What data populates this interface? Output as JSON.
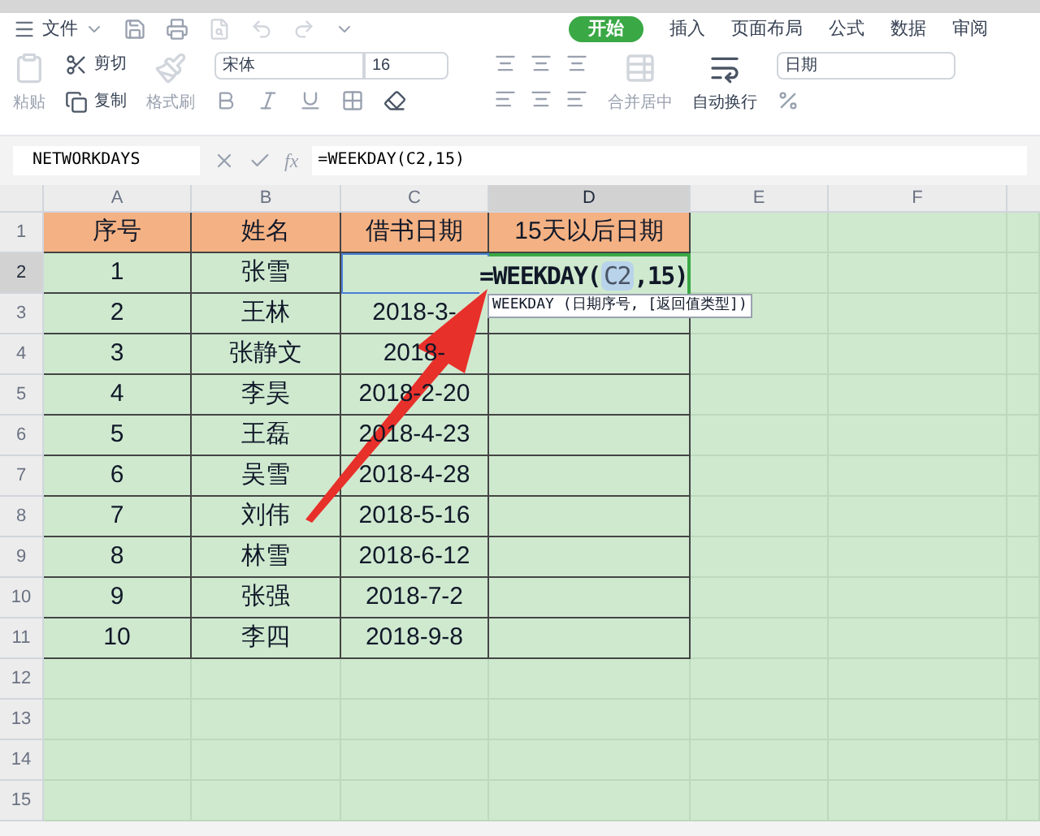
{
  "menu": {
    "file": "文件",
    "tabs": [
      {
        "label": "开始",
        "selected": true
      },
      {
        "label": "插入",
        "selected": false
      },
      {
        "label": "页面布局",
        "selected": false
      },
      {
        "label": "公式",
        "selected": false
      },
      {
        "label": "数据",
        "selected": false
      },
      {
        "label": "审阅",
        "selected": false
      }
    ]
  },
  "ribbon": {
    "paste": "粘贴",
    "cut": "剪切",
    "copy": "复制",
    "format_painter": "格式刷",
    "font": "宋体",
    "size": "16",
    "merge": "合并居中",
    "wrap": "自动换行",
    "number_format": "日期"
  },
  "formula_bar": {
    "name_box": "NETWORKDAYS",
    "function_label": "fx",
    "formula": "=WEEKDAY(C2,15)"
  },
  "columns": [
    {
      "label": "A",
      "selected": false
    },
    {
      "label": "B",
      "selected": false
    },
    {
      "label": "C",
      "selected": false
    },
    {
      "label": "D",
      "selected": true
    },
    {
      "label": "E",
      "selected": false
    },
    {
      "label": "F",
      "selected": false
    }
  ],
  "rows": [
    {
      "label": "1",
      "selected": false,
      "cells": [
        "序号",
        "姓名",
        "借书日期",
        "15天以后日期"
      ]
    },
    {
      "label": "2",
      "selected": true,
      "cells": [
        "1",
        "张雪",
        "",
        ""
      ]
    },
    {
      "label": "3",
      "selected": false,
      "cells": [
        "2",
        "王林",
        "2018-3-",
        ""
      ]
    },
    {
      "label": "4",
      "selected": false,
      "cells": [
        "3",
        "张静文",
        "2018-",
        ""
      ]
    },
    {
      "label": "5",
      "selected": false,
      "cells": [
        "4",
        "李昊",
        "2018-2-20",
        ""
      ]
    },
    {
      "label": "6",
      "selected": false,
      "cells": [
        "5",
        "王磊",
        "2018-4-23",
        ""
      ]
    },
    {
      "label": "7",
      "selected": false,
      "cells": [
        "6",
        "吴雪",
        "2018-4-28",
        ""
      ]
    },
    {
      "label": "8",
      "selected": false,
      "cells": [
        "7",
        "刘伟",
        "2018-5-16",
        ""
      ]
    },
    {
      "label": "9",
      "selected": false,
      "cells": [
        "8",
        "林雪",
        "2018-6-12",
        ""
      ]
    },
    {
      "label": "10",
      "selected": false,
      "cells": [
        "9",
        "张强",
        "2018-7-2",
        ""
      ]
    },
    {
      "label": "11",
      "selected": false,
      "cells": [
        "10",
        "李四",
        "2018-9-8",
        ""
      ]
    },
    {
      "label": "12",
      "selected": false,
      "cells": []
    },
    {
      "label": "13",
      "selected": false,
      "cells": []
    },
    {
      "label": "14",
      "selected": false,
      "cells": []
    },
    {
      "label": "15",
      "selected": false,
      "cells": []
    }
  ],
  "cell_editor": {
    "prefix": "=WEEKDAY(",
    "reference": "C2",
    "suffix": ",15)",
    "hint": "WEEKDAY (日期序号, [返回值类型])"
  }
}
